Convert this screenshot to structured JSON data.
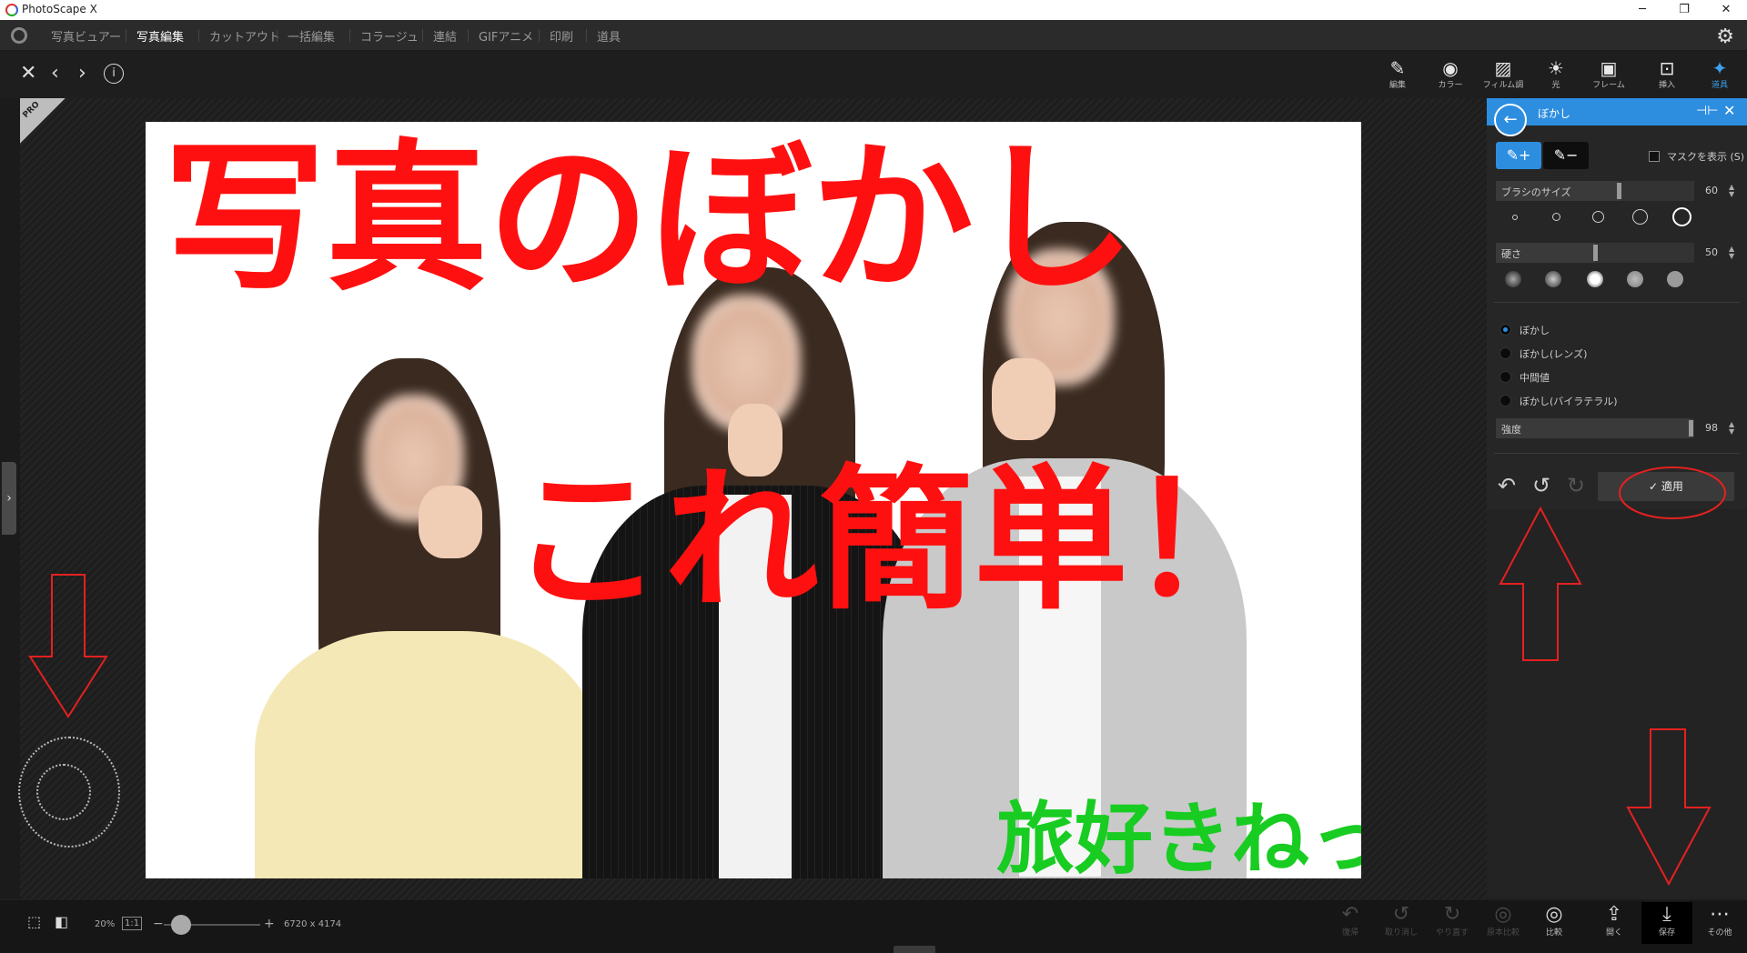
{
  "titlebar": {
    "app_title": "PhotoScape X",
    "minimize": "─",
    "restore": "❐",
    "close": "✕"
  },
  "menu": {
    "items": [
      {
        "label": "写真ビュアー"
      },
      {
        "label": "写真編集"
      },
      {
        "label": "カットアウト"
      },
      {
        "label": "一括編集"
      },
      {
        "label": "コラージュ"
      },
      {
        "label": "連結"
      },
      {
        "label": "GIFアニメ"
      },
      {
        "label": "印刷"
      },
      {
        "label": "道具"
      }
    ],
    "active_index": 1,
    "settings_icon": "gear-icon"
  },
  "toolbar": {
    "tools": [
      {
        "label": "編集",
        "icon": "edit-icon"
      },
      {
        "label": "カラー",
        "icon": "color-icon"
      },
      {
        "label": "フィルム調",
        "icon": "film-icon"
      },
      {
        "label": "光",
        "icon": "light-icon"
      },
      {
        "label": "フレーム",
        "icon": "frame-icon"
      },
      {
        "label": "挿入",
        "icon": "insert-icon"
      },
      {
        "label": "道具",
        "icon": "tools-icon"
      }
    ],
    "active_tool": "道具"
  },
  "canvas": {
    "pro_badge": "PRO",
    "overlay_title": "写真のぼかし",
    "overlay_subtitle": "これ簡単！",
    "watermark": "旅好きねっと"
  },
  "panel": {
    "title": "ぼかし",
    "show_mask_label": "マスクを表示 (S)",
    "brush_size": {
      "label": "ブラシのサイズ",
      "value": "60",
      "fraction": 0.62
    },
    "hardness": {
      "label": "硬さ",
      "value": "50",
      "fraction": 0.5
    },
    "modes": [
      {
        "label": "ぼかし",
        "selected": true
      },
      {
        "label": "ぼかし(レンズ)",
        "selected": false
      },
      {
        "label": "中間値",
        "selected": false
      },
      {
        "label": "ぼかし(バイラテラル)",
        "selected": false
      }
    ],
    "strength": {
      "label": "強度",
      "value": "98",
      "fraction": 0.98
    },
    "apply_label": "適用"
  },
  "statusbar": {
    "zoom": "20%",
    "one_to_one": "1:1",
    "minus": "−",
    "plus": "+",
    "dimensions": "6720 x 4174",
    "actions": [
      {
        "label": "復帰",
        "enabled": false
      },
      {
        "label": "取り消し",
        "enabled": false
      },
      {
        "label": "やり直す",
        "enabled": false
      },
      {
        "label": "原本比較",
        "enabled": false
      },
      {
        "label": "比較",
        "enabled": true
      },
      {
        "label": "開く",
        "enabled": true
      },
      {
        "label": "保存",
        "enabled": true
      },
      {
        "label": "その他",
        "enabled": true
      }
    ]
  },
  "colors": {
    "accent": "#2d8ee0",
    "annotation_red": "#ff1010",
    "watermark_green": "#18cc22"
  }
}
